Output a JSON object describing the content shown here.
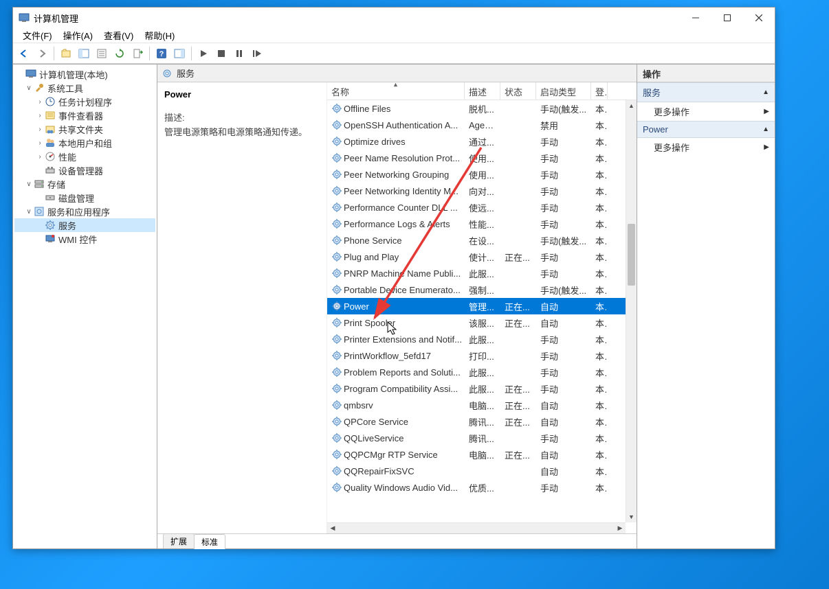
{
  "window": {
    "title": "计算机管理"
  },
  "menubar": {
    "items": [
      "文件(F)",
      "操作(A)",
      "查看(V)",
      "帮助(H)"
    ]
  },
  "tree": {
    "root": "计算机管理(本地)",
    "system_tools": "系统工具",
    "task_scheduler": "任务计划程序",
    "event_viewer": "事件查看器",
    "shared_folders": "共享文件夹",
    "local_users": "本地用户和组",
    "performance": "性能",
    "device_manager": "设备管理器",
    "storage": "存储",
    "disk_mgmt": "磁盘管理",
    "services_apps": "服务和应用程序",
    "services": "服务",
    "wmi": "WMI 控件"
  },
  "center": {
    "header": "服务",
    "detail": {
      "title": "Power",
      "desc_label": "描述:",
      "desc_text": "管理电源策略和电源策略通知传递。"
    },
    "columns": {
      "name": "名称",
      "desc": "描述",
      "status": "状态",
      "start": "启动类型",
      "logon": "登"
    },
    "tabs": {
      "extended": "扩展",
      "standard": "标准"
    }
  },
  "services": [
    {
      "name": "Offline Files",
      "desc": "脱机...",
      "status": "",
      "start": "手动(触发...",
      "logon": "本"
    },
    {
      "name": "OpenSSH Authentication A...",
      "desc": "Agen...",
      "status": "",
      "start": "禁用",
      "logon": "本"
    },
    {
      "name": "Optimize drives",
      "desc": "通过...",
      "status": "",
      "start": "手动",
      "logon": "本"
    },
    {
      "name": "Peer Name Resolution Prot...",
      "desc": "使用...",
      "status": "",
      "start": "手动",
      "logon": "本"
    },
    {
      "name": "Peer Networking Grouping",
      "desc": "使用...",
      "status": "",
      "start": "手动",
      "logon": "本"
    },
    {
      "name": "Peer Networking Identity M...",
      "desc": "向对...",
      "status": "",
      "start": "手动",
      "logon": "本"
    },
    {
      "name": "Performance Counter DLL ...",
      "desc": "使远...",
      "status": "",
      "start": "手动",
      "logon": "本"
    },
    {
      "name": "Performance Logs & Alerts",
      "desc": "性能...",
      "status": "",
      "start": "手动",
      "logon": "本"
    },
    {
      "name": "Phone Service",
      "desc": "在设...",
      "status": "",
      "start": "手动(触发...",
      "logon": "本"
    },
    {
      "name": "Plug and Play",
      "desc": "使计...",
      "status": "正在...",
      "start": "手动",
      "logon": "本"
    },
    {
      "name": "PNRP Machine Name Publi...",
      "desc": "此服...",
      "status": "",
      "start": "手动",
      "logon": "本"
    },
    {
      "name": "Portable Device Enumerato...",
      "desc": "强制...",
      "status": "",
      "start": "手动(触发...",
      "logon": "本"
    },
    {
      "name": "Power",
      "desc": "管理...",
      "status": "正在...",
      "start": "自动",
      "logon": "本",
      "selected": true
    },
    {
      "name": "Print Spooler",
      "desc": "该服...",
      "status": "正在...",
      "start": "自动",
      "logon": "本"
    },
    {
      "name": "Printer Extensions and Notif...",
      "desc": "此服...",
      "status": "",
      "start": "手动",
      "logon": "本"
    },
    {
      "name": "PrintWorkflow_5efd17",
      "desc": "打印...",
      "status": "",
      "start": "手动",
      "logon": "本"
    },
    {
      "name": "Problem Reports and Soluti...",
      "desc": "此服...",
      "status": "",
      "start": "手动",
      "logon": "本"
    },
    {
      "name": "Program Compatibility Assi...",
      "desc": "此服...",
      "status": "正在...",
      "start": "手动",
      "logon": "本"
    },
    {
      "name": "qmbsrv",
      "desc": "电脑...",
      "status": "正在...",
      "start": "自动",
      "logon": "本"
    },
    {
      "name": "QPCore Service",
      "desc": "腾讯...",
      "status": "正在...",
      "start": "自动",
      "logon": "本"
    },
    {
      "name": "QQLiveService",
      "desc": "腾讯...",
      "status": "",
      "start": "手动",
      "logon": "本"
    },
    {
      "name": "QQPCMgr RTP Service",
      "desc": "电脑...",
      "status": "正在...",
      "start": "自动",
      "logon": "本"
    },
    {
      "name": "QQRepairFixSVC",
      "desc": "",
      "status": "",
      "start": "自动",
      "logon": "本"
    },
    {
      "name": "Quality Windows Audio Vid...",
      "desc": "优质...",
      "status": "",
      "start": "手动",
      "logon": "本"
    }
  ],
  "actions": {
    "header": "操作",
    "group1": "服务",
    "more1": "更多操作",
    "group2": "Power",
    "more2": "更多操作"
  }
}
